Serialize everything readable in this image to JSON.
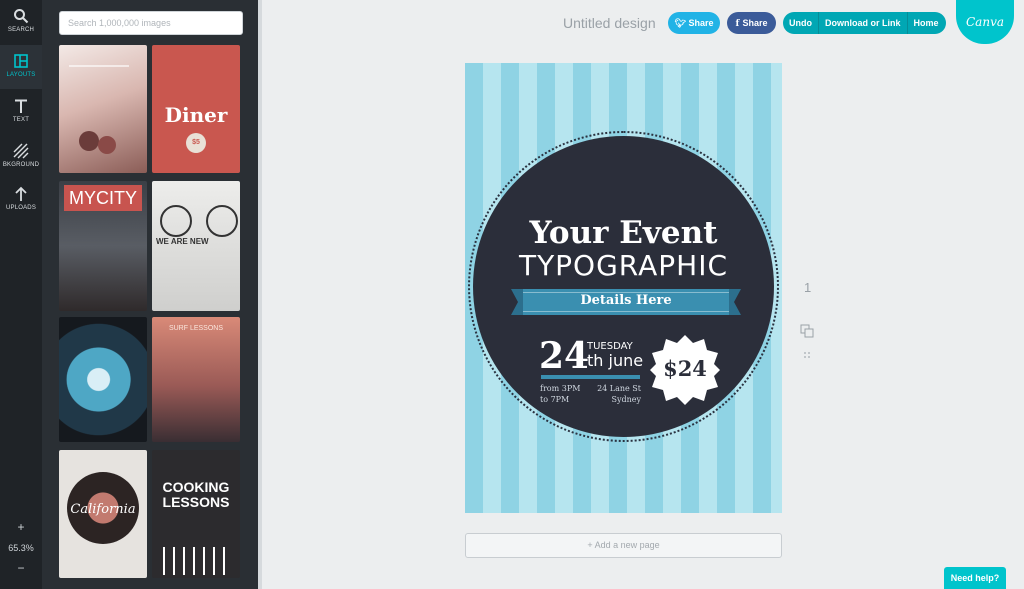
{
  "rail": {
    "items": [
      {
        "label": "SEARCH",
        "icon": "search-icon"
      },
      {
        "label": "LAYOUTS",
        "icon": "layouts-icon"
      },
      {
        "label": "TEXT",
        "icon": "text-icon"
      },
      {
        "label": "BKGROUND",
        "icon": "background-icon"
      },
      {
        "label": "UPLOADS",
        "icon": "upload-icon"
      }
    ],
    "zoom_in": "+",
    "zoom_level": "65.3%",
    "zoom_out": "−"
  },
  "panel": {
    "search_placeholder": "Search 1,000,000 images",
    "templates": [
      {
        "name": "template-wedding"
      },
      {
        "name": "template-diner",
        "text": "Diner",
        "sub": "$5"
      },
      {
        "name": "template-mycity",
        "text": "MYCITY"
      },
      {
        "name": "template-we-are-new",
        "text": "WE ARE NEW"
      },
      {
        "name": "template-circle-blue"
      },
      {
        "name": "template-surf-lessons",
        "text": "SURF LESSONS"
      },
      {
        "name": "template-california",
        "text": "California"
      },
      {
        "name": "template-cooking-lessons",
        "text": "COOKING\nLESSONS"
      }
    ]
  },
  "topbar": {
    "title": "Untitled design",
    "twitter_share": "Share",
    "facebook_share": "Share",
    "undo": "Undo",
    "download": "Download or Link",
    "home": "Home",
    "logo": "Canva"
  },
  "canvas": {
    "title": "Your Event",
    "subtitle": "TYPOGRAPHIC",
    "details": "Details Here",
    "day": "24",
    "weekday": "TUESDAY",
    "month": "th june",
    "time_line1": "from 3PM",
    "time_line2": "to 7PM",
    "address_line1": "24 Lane St",
    "address_line2": "Sydney",
    "price": "$24",
    "colors": {
      "stripe_a": "#8fd3e4",
      "stripe_b": "#b6e5ef",
      "circle": "#2b2e3a",
      "accent": "#3a8fb0"
    }
  },
  "side_tools": {
    "page_number": "1"
  },
  "add_page": "+ Add a new page",
  "help": "Need help?"
}
